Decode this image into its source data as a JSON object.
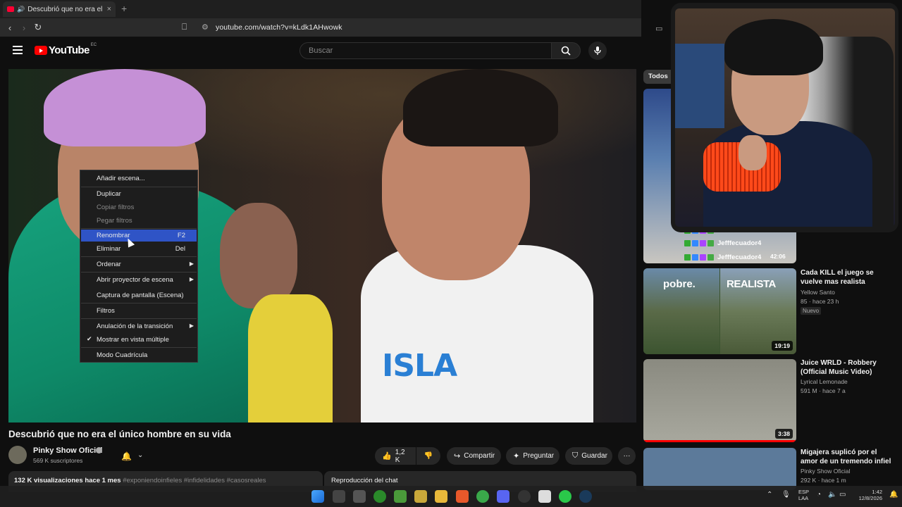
{
  "browser": {
    "tab_title": "Descubrió que no era el único",
    "tab_close": "×",
    "new_tab": "+",
    "back": "‹",
    "forward": "›",
    "reload": "↻",
    "url": "youtube.com/watch?v=kLdk1AHwowk"
  },
  "youtube": {
    "logo": "YouTube",
    "country": "EC",
    "search_placeholder": "Buscar"
  },
  "context_menu": {
    "items": [
      {
        "label": "Añadir escena...",
        "shortcut": ""
      },
      {
        "label": "Duplicar",
        "shortcut": ""
      },
      {
        "label": "Copiar filtros",
        "shortcut": ""
      },
      {
        "label": "Pegar filtros",
        "shortcut": ""
      },
      {
        "label": "Renombrar",
        "shortcut": "F2"
      },
      {
        "label": "Eliminar",
        "shortcut": "Del"
      },
      {
        "label": "Ordenar",
        "shortcut": ""
      },
      {
        "label": "Abrir proyector de escena",
        "shortcut": ""
      },
      {
        "label": "Captura de pantalla (Escena)",
        "shortcut": ""
      },
      {
        "label": "Filtros",
        "shortcut": ""
      },
      {
        "label": "Anulación de la transición",
        "shortcut": ""
      },
      {
        "label": "Mostrar en vista múltiple",
        "shortcut": ""
      },
      {
        "label": "Modo Cuadrícula",
        "shortcut": ""
      }
    ]
  },
  "video": {
    "shirt_text": "ISLA",
    "title": "Descubrió que no era el único hombre en su vida",
    "channel": "Pinky Show Oficial",
    "subscribers": "569 K suscriptores",
    "likes": "1,2 K",
    "share": "Compartir",
    "ask": "Preguntar",
    "save": "Guardar",
    "more": "···",
    "views": "132 K visualizaciones",
    "age": "hace 1 mes",
    "tags": "#exponiendoinfieles #infidelidades #casosreales",
    "chat_replay": "Reproducción del chat"
  },
  "sidebar": {
    "chip": "Todos",
    "thumb1_duration": "42:06",
    "chat_user_1": "Jefffecuador4",
    "chat_user_2": "Jefffecuador4",
    "thumb2_left": "pobre.",
    "thumb2_right": "REALISTA",
    "recs": [
      {
        "title": "Cada KILL el juego se vuelve mas realista",
        "channel": "Yellow Santo",
        "meta": "85 · hace 23 h",
        "badge": "Nuevo",
        "duration": "19:19"
      },
      {
        "title": "Juice WRLD - Robbery (Official Music Video)",
        "channel": "Lyrical Lemonade",
        "meta": "591 M · hace 7 a",
        "duration": "3:38"
      },
      {
        "title": "Migajera suplicó por el amor de un tremendo infiel",
        "channel": "Pinky Show Oficial",
        "meta": "292 K · hace 1 m"
      }
    ]
  },
  "taskbar": {
    "lang_1": "ESP",
    "lang_2": "LAA",
    "time": "1:42",
    "date": "12/8/2026"
  }
}
